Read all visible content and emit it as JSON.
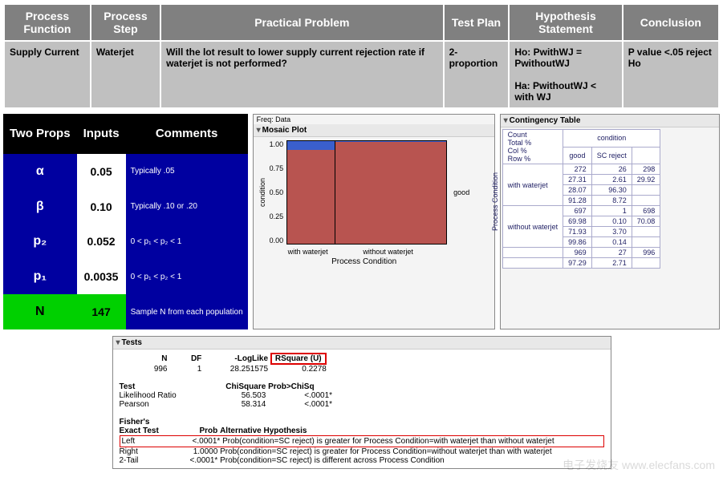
{
  "main_table": {
    "headers": [
      "Process Function",
      "Process Step",
      "Practical Problem",
      "Test Plan",
      "Hypothesis Statement",
      "Conclusion"
    ],
    "row": {
      "process_function": "Supply Current",
      "process_step": "Waterjet",
      "practical_problem": "Will the lot result to lower  supply current rejection rate if waterjet is not performed?",
      "test_plan": "2-proportion",
      "hypothesis": "Ho: PwithWJ = PwithoutWJ\n\nHa: PwithoutWJ < with WJ",
      "conclusion": "P value <.05 reject Ho"
    }
  },
  "two_props": {
    "title": "Two Props",
    "col_inputs": "Inputs",
    "col_comments": "Comments",
    "rows": [
      {
        "label": "α",
        "value": "0.05",
        "comment": "Typically .05"
      },
      {
        "label": "β",
        "value": "0.10",
        "comment": "Typically .10 or .20"
      },
      {
        "label": "p₂",
        "value": "0.052",
        "comment": "0 < p₁ < p₂ < 1"
      },
      {
        "label": "p₁",
        "value": "0.0035",
        "comment": "0 < p₁ < p₂ < 1"
      }
    ],
    "n_row": {
      "label": "N",
      "value": "147",
      "comment": "Sample N from each population"
    }
  },
  "mosaic": {
    "freq_label": "Freq: Data",
    "title": "Mosaic Plot",
    "yticks": [
      "1.00",
      "0.75",
      "0.50",
      "0.25",
      "0.00"
    ],
    "ylabel": "condition",
    "xlabel": "Process Condition",
    "xcat1": "with waterjet",
    "xcat2": "without waterjet",
    "legend_good": "good"
  },
  "contingency": {
    "title": "Contingency Table",
    "cond_label": "condition",
    "proc_label": "Process Condition",
    "header_lines": [
      "Count",
      "Total %",
      "Col %",
      "Row %"
    ],
    "cols": [
      "good",
      "SC reject"
    ],
    "rows": [
      {
        "name": "with waterjet",
        "cells": [
          "272",
          "26",
          "298",
          "27.31",
          "2.61",
          "29.92",
          "28.07",
          "96.30",
          "",
          "91.28",
          "8.72",
          ""
        ]
      },
      {
        "name": "without waterjet",
        "cells": [
          "697",
          "1",
          "698",
          "69.98",
          "0.10",
          "70.08",
          "71.93",
          "3.70",
          "",
          "99.86",
          "0.14",
          ""
        ]
      }
    ],
    "totals": [
      "969",
      "27",
      "996",
      "97.29",
      "2.71",
      ""
    ]
  },
  "tests": {
    "title": "Tests",
    "summary_headers": [
      "N",
      "DF",
      "-LogLike",
      "RSquare (U)"
    ],
    "summary_values": [
      "996",
      "1",
      "28.251575",
      "0.2278"
    ],
    "test_headers": [
      "Test",
      "ChiSquare",
      "Prob>ChiSq"
    ],
    "test_rows": [
      {
        "name": "Likelihood Ratio",
        "chi": "56.503",
        "p": "<.0001*"
      },
      {
        "name": "Pearson",
        "chi": "58.314",
        "p": "<.0001*"
      }
    ],
    "fisher_title": "Fisher's",
    "fisher_headers": [
      "Exact Test",
      "Prob",
      "Alternative Hypothesis"
    ],
    "fisher_rows": [
      {
        "side": "Left",
        "p": "<.0001*",
        "alt": "Prob(condition=SC reject) is greater for Process Condition=with waterjet than without waterjet"
      },
      {
        "side": "Right",
        "p": "1.0000",
        "alt": "Prob(condition=SC reject) is greater for Process Condition=without waterjet than with waterjet"
      },
      {
        "side": "2-Tail",
        "p": "<.0001*",
        "alt": "Prob(condition=SC reject) is different across Process Condition"
      }
    ]
  },
  "watermark": "电子发烧友 www.elecfans.com",
  "chart_data": {
    "type": "bar",
    "title": "Mosaic Plot",
    "xlabel": "Process Condition",
    "ylabel": "condition",
    "categories": [
      "with waterjet",
      "without waterjet"
    ],
    "series": [
      {
        "name": "good",
        "values": [
          272,
          697
        ]
      },
      {
        "name": "SC reject",
        "values": [
          26,
          1
        ]
      }
    ],
    "column_widths": [
      0.299,
      0.701
    ],
    "ylim": [
      0,
      1
    ]
  }
}
